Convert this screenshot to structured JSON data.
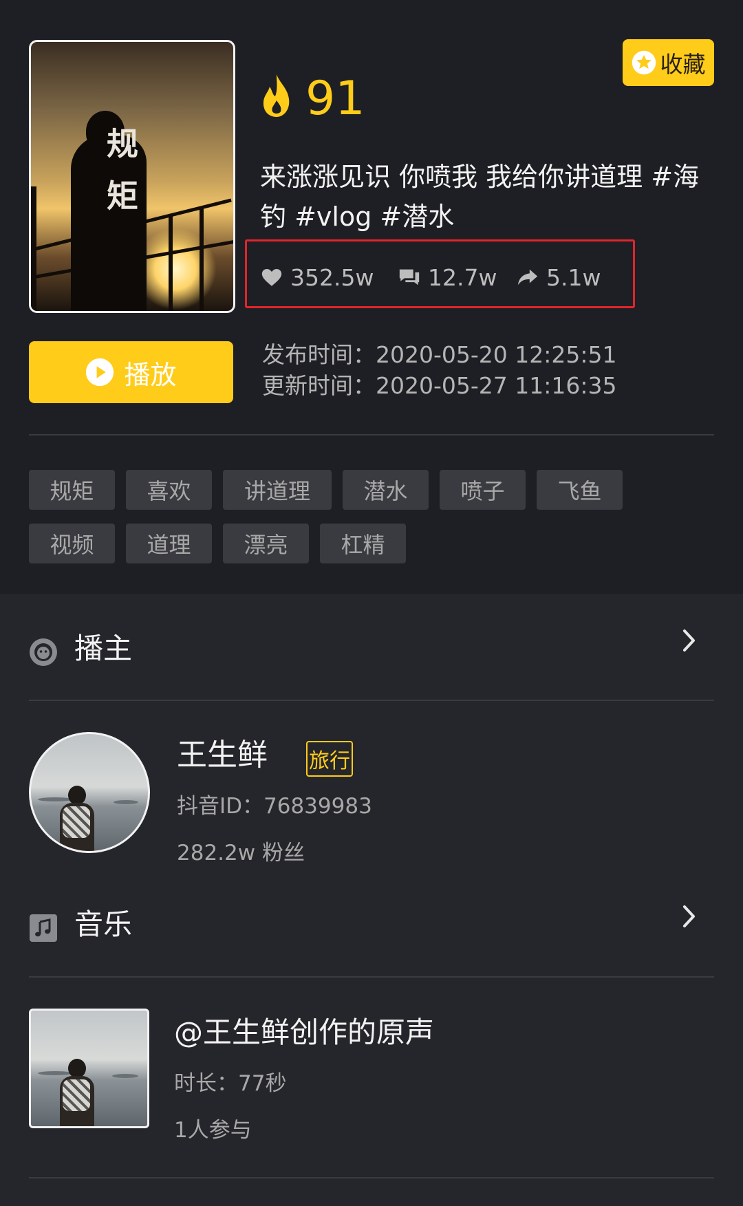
{
  "video": {
    "cover_title_chars": [
      "规",
      "矩"
    ],
    "score": "91",
    "favorite_label": "收藏",
    "description_line1": "来涨涨见识 你喷我 我给你讲道理 #海",
    "description_line2": "钓 #vlog #潜水",
    "stats": {
      "likes": "352.5w",
      "comments": "12.7w",
      "shares": "5.1w"
    },
    "play_label": "播放",
    "publish_time": "发布时间：2020-05-20 12:25:51",
    "update_time": "更新时间：2020-05-27 11:16:35",
    "tags": [
      "规矩",
      "喜欢",
      "讲道理",
      "潜水",
      "喷子",
      "飞鱼",
      "视频",
      "道理",
      "漂亮",
      "杠精"
    ]
  },
  "creator_section": {
    "title": "播主",
    "name": "王生鲜",
    "category": "旅行",
    "douyin_id": "抖音ID：76839983",
    "followers": "282.2w 粉丝"
  },
  "music_section": {
    "title": "音乐",
    "track_title": "@王生鲜创作的原声",
    "duration": "时长：77秒",
    "participants": "1人参与"
  },
  "colors": {
    "accent": "#ffcc1a",
    "background_top": "#1e1f24",
    "background_bottom": "#25262b",
    "highlight_border": "#e0252a"
  },
  "icons": [
    "fire-icon",
    "star-icon",
    "heart-icon",
    "comment-icon",
    "share-icon",
    "play-icon",
    "creator-icon",
    "music-icon",
    "chevron-right-icon"
  ]
}
